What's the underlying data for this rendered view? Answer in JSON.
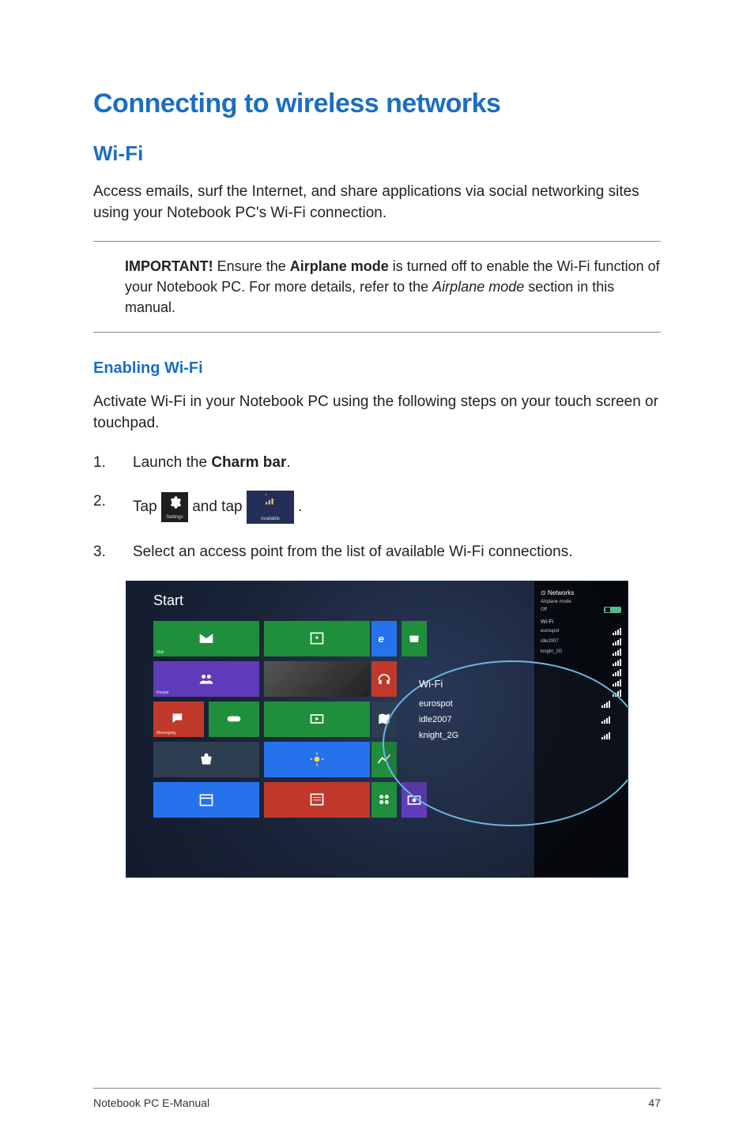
{
  "heading_main": "Connecting to wireless networks",
  "heading_wifi": "Wi-Fi",
  "intro_text": "Access emails, surf the Internet, and share applications via social networking sites using your Notebook PC's Wi-Fi connection.",
  "important_label": "IMPORTANT!",
  "important_pre": " Ensure the ",
  "important_bold": "Airplane mode",
  "important_post": " is turned off to enable the Wi-Fi function of your Notebook PC. For more details, refer to the ",
  "important_italic": "Airplane mode",
  "important_tail": " section in this manual.",
  "heading_enable": "Enabling Wi-Fi",
  "enable_intro": "Activate Wi-Fi in your Notebook PC using the following steps on your touch screen or touchpad.",
  "steps": {
    "s1_num": "1.",
    "s1_pre": "Launch the ",
    "s1_bold": "Charm bar",
    "s1_post": ".",
    "s2_num": "2.",
    "s2_pre": "Tap ",
    "s2_mid": " and tap ",
    "s2_post": ".",
    "s3_num": "3.",
    "s3_text": "Select an access point from the list of available Wi-Fi connections."
  },
  "icon_settings_sub": "Settings",
  "icon_available_sub": "Available",
  "screenshot": {
    "start_label": "Start",
    "tiles": {
      "mail": "Mail",
      "people": "People",
      "messaging": "Messaging",
      "games": "",
      "store": "",
      "photos": "",
      "video": "",
      "weather": "",
      "calendar": "",
      "news": "",
      "ie": "",
      "music": "",
      "maps": "",
      "finance": "",
      "sports": "",
      "camera": ""
    },
    "networks_panel": {
      "title": "Networks",
      "airplane_label": "Airplane mode",
      "airplane_state": "Off",
      "wifi_label": "Wi-Fi",
      "row1": "eurospot",
      "row2": "idle2007",
      "row3": "knight_2G"
    },
    "wifi_popup": {
      "title": "Wi-Fi",
      "items": [
        "eurospot",
        "idle2007",
        "knight_2G"
      ]
    }
  },
  "footer_left": "Notebook PC E-Manual",
  "footer_right": "47"
}
